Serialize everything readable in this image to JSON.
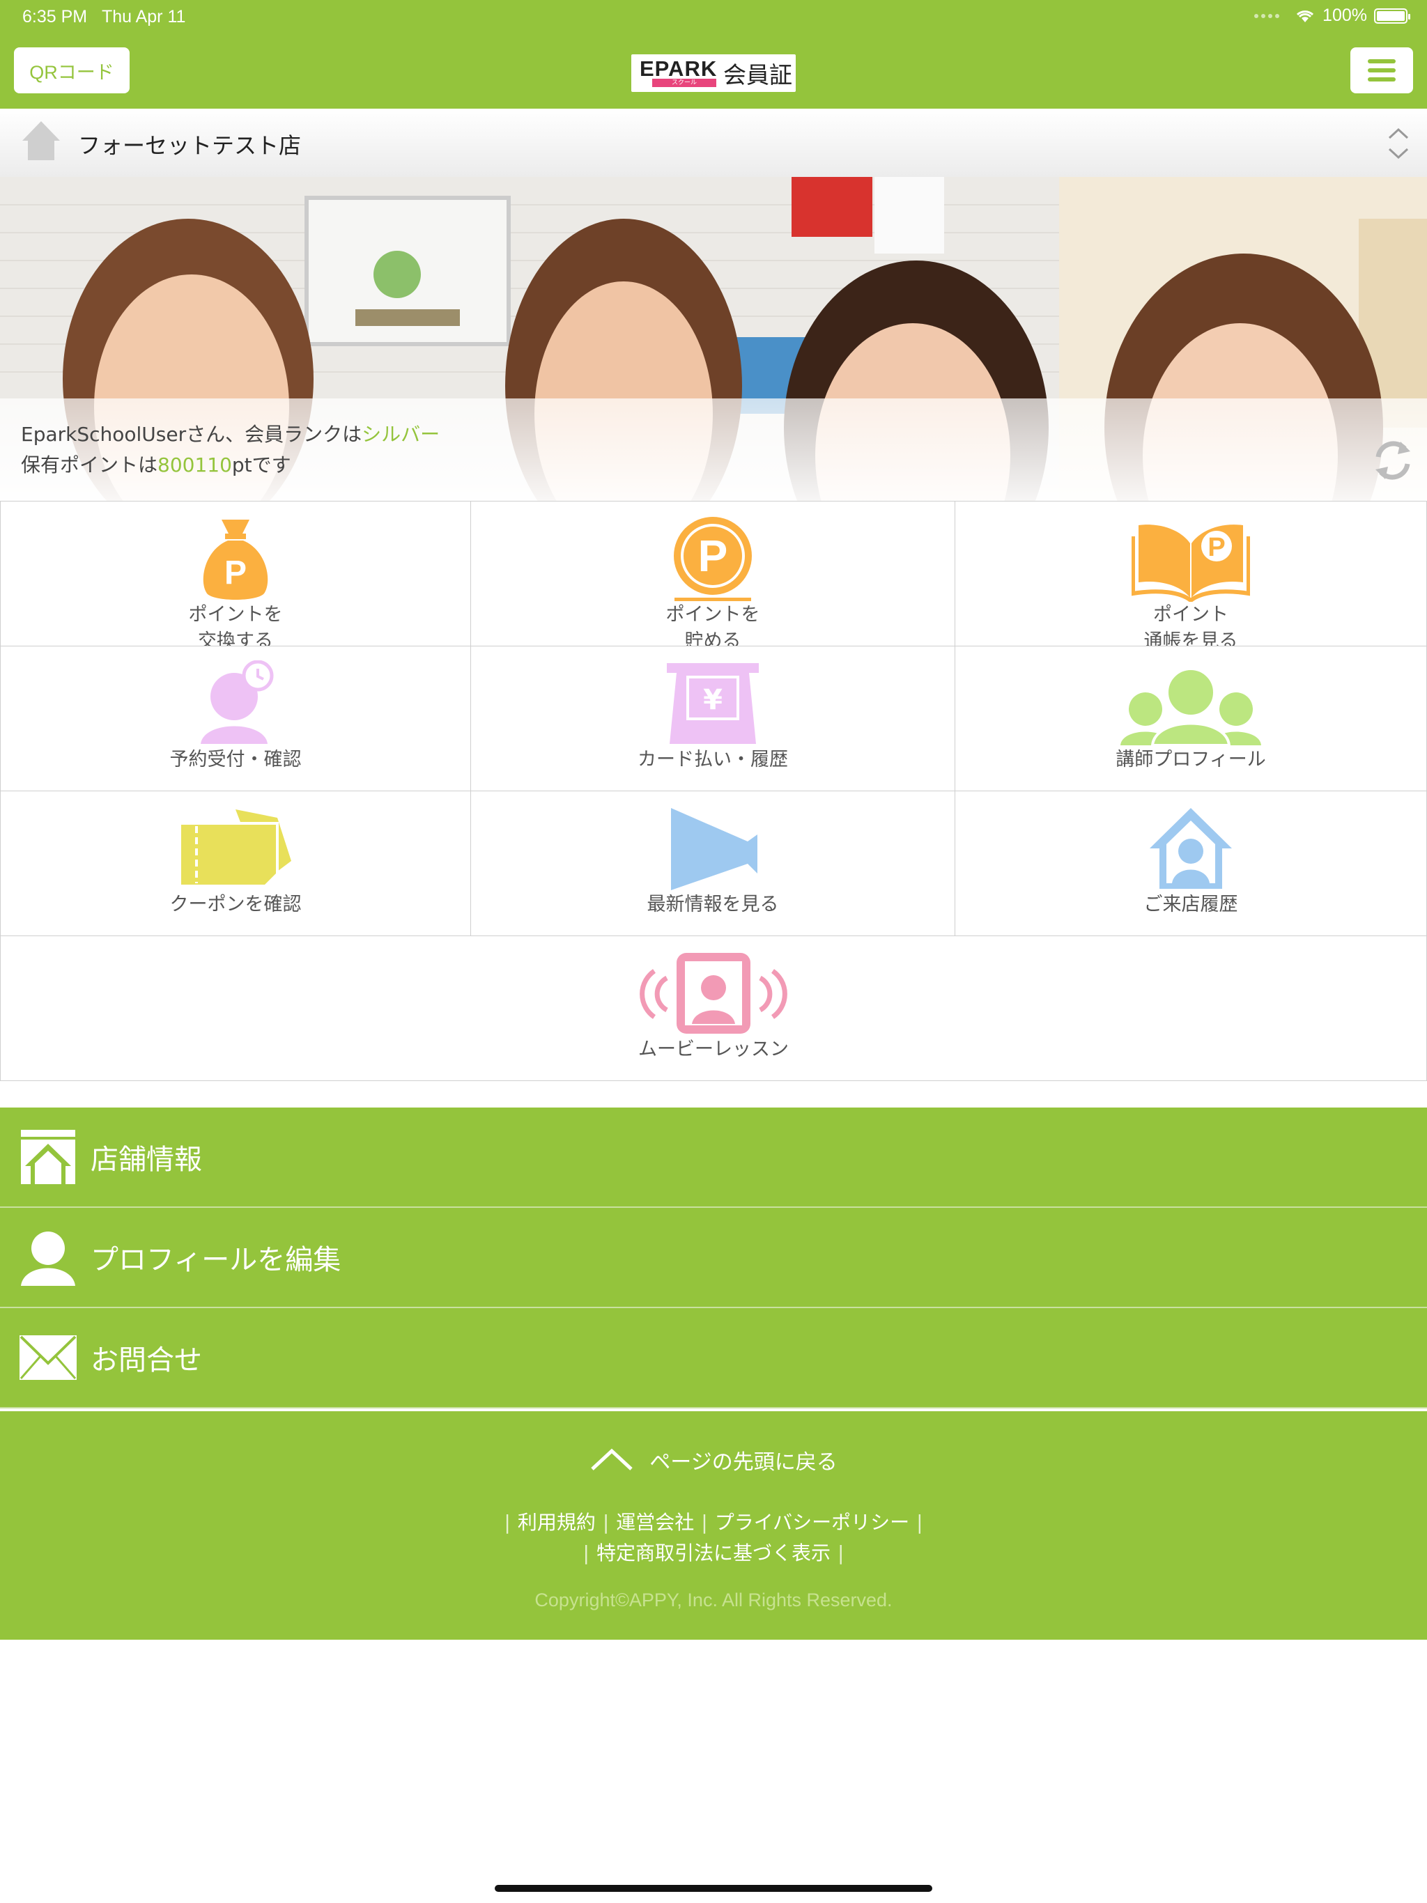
{
  "status_bar": {
    "time": "6:35 PM",
    "date": "Thu Apr 11",
    "battery": "100%"
  },
  "nav": {
    "qr_label": "QRコード",
    "logo_brand": "EPARK",
    "logo_sub": "スクール",
    "logo_title": "会員証"
  },
  "shop": {
    "name": "フォーセットテスト店"
  },
  "member": {
    "line1_prefix": "EparkSchoolUserさん、会員ランクは",
    "rank": "シルバー",
    "line2_prefix": "保有ポイントは",
    "points": "800110",
    "line2_suffix": "ptです"
  },
  "grid": {
    "exchange_points": [
      "ポイントを",
      "交換する"
    ],
    "earn_points": [
      "ポイントを",
      "貯める"
    ],
    "point_book": [
      "ポイント",
      "通帳を見る"
    ],
    "reservation": "予約受付・確認",
    "card_payment": "カード払い・履歴",
    "instructor": "講師プロフィール",
    "coupon": "クーポンを確認",
    "news": "最新情報を見る",
    "visit_history": "ご来店履歴",
    "movie_lesson": "ムービーレッスン"
  },
  "menu": {
    "store_info": "店舗情報",
    "edit_profile": "プロフィールを編集",
    "contact": "お問合せ"
  },
  "footer": {
    "page_top": "ページの先頭に戻る",
    "terms": "利用規約",
    "company": "運営会社",
    "privacy": "プライバシーポリシー",
    "tokusho": "特定商取引法に基づく表示",
    "copyright": "Copyright©APPY, Inc. All Rights Reserved."
  },
  "colors": {
    "accent": "#94c43c",
    "orange": "#fbb040",
    "pink": "#f5a3c7",
    "violet": "#eec2f5",
    "yellow": "#e8e05a",
    "blue": "#9ec9f0",
    "lime": "#bce680"
  }
}
